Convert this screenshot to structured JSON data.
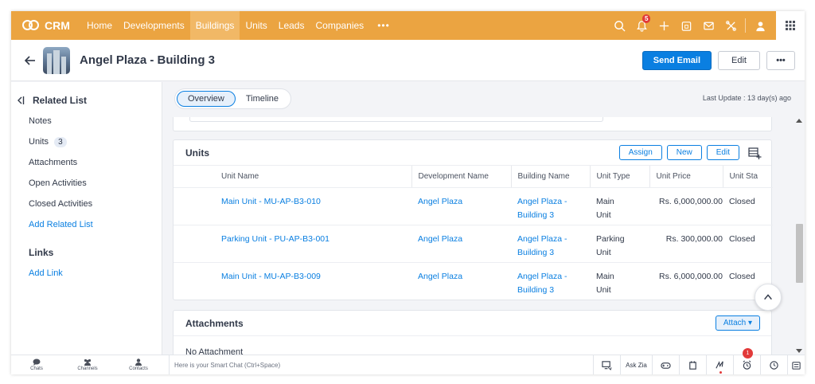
{
  "app": {
    "name": "CRM"
  },
  "nav": {
    "tabs": [
      {
        "label": "Home"
      },
      {
        "label": "Developments"
      },
      {
        "label": "Buildings"
      },
      {
        "label": "Units"
      },
      {
        "label": "Leads"
      },
      {
        "label": "Companies"
      }
    ],
    "more_label": "•••",
    "notifications_count": "5"
  },
  "record": {
    "title": "Angel Plaza - Building 3",
    "send_email_label": "Send Email",
    "edit_label": "Edit",
    "more_label": "•••"
  },
  "sidebar": {
    "related_title": "Related List",
    "items": [
      {
        "label": "Notes"
      },
      {
        "label": "Units",
        "count": "3"
      },
      {
        "label": "Attachments"
      },
      {
        "label": "Open Activities"
      },
      {
        "label": "Closed Activities"
      }
    ],
    "add_related_label": "Add Related List",
    "links_title": "Links",
    "add_link_label": "Add Link"
  },
  "view_tabs": {
    "overview": "Overview",
    "timeline": "Timeline",
    "last_update": "Last Update : 13 day(s) ago"
  },
  "units": {
    "title": "Units",
    "assign_label": "Assign",
    "new_label": "New",
    "edit_label": "Edit",
    "columns": [
      "Unit Name",
      "Development Name",
      "Building Name",
      "Unit Type",
      "Unit Price",
      "Unit Sta"
    ],
    "rows": [
      {
        "unit_name": "Main Unit - MU-AP-B3-010",
        "development": "Angel Plaza",
        "building_l1": "Angel Plaza -",
        "building_l2": "Building 3",
        "type_l1": "Main",
        "type_l2": "Unit",
        "price": "Rs. 6,000,000.00",
        "status": "Closed"
      },
      {
        "unit_name": "Parking Unit - PU-AP-B3-001",
        "development": "Angel Plaza",
        "building_l1": "Angel Plaza -",
        "building_l2": "Building 3",
        "type_l1": "Parking",
        "type_l2": "Unit",
        "price": "Rs. 300,000.00",
        "status": "Closed"
      },
      {
        "unit_name": "Main Unit - MU-AP-B3-009",
        "development": "Angel Plaza",
        "building_l1": "Angel Plaza -",
        "building_l2": "Building 3",
        "type_l1": "Main",
        "type_l2": "Unit",
        "price": "Rs. 6,000,000.00",
        "status": "Closed"
      }
    ]
  },
  "attachments": {
    "title": "Attachments",
    "attach_label": "Attach ▾",
    "empty_text": "No Attachment"
  },
  "footer": {
    "chats_label": "Chats",
    "channels_label": "Channels",
    "contacts_label": "Contacts",
    "smart_chat_placeholder": "Here is your Smart Chat (Ctrl+Space)",
    "ask_zia_label": "Ask Zia",
    "alarm_count": "1"
  },
  "colors": {
    "nav_bg": "#eba441",
    "nav_active": "#f1b866",
    "primary": "#0a7fe1",
    "badge": "#e23a3a"
  }
}
